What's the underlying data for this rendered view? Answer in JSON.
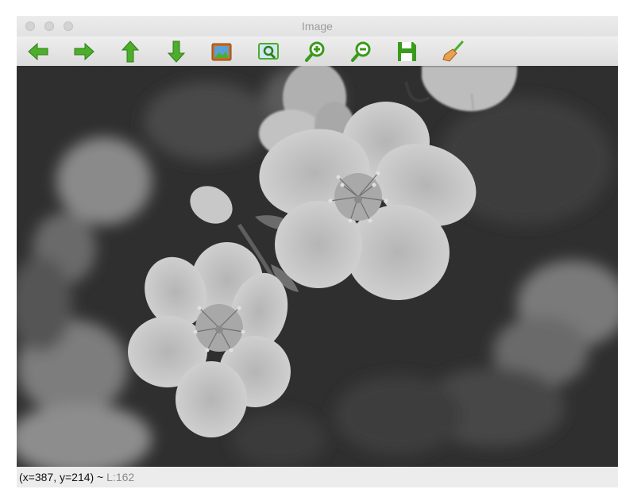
{
  "window": {
    "title": "Image"
  },
  "toolbar": {
    "buttons": [
      {
        "id": "back",
        "icon": "arrow-left-icon"
      },
      {
        "id": "forward",
        "icon": "arrow-right-icon"
      },
      {
        "id": "up",
        "icon": "arrow-up-icon"
      },
      {
        "id": "down",
        "icon": "arrow-down-icon"
      },
      {
        "id": "image",
        "icon": "picture-icon"
      },
      {
        "id": "zoom-fit",
        "icon": "zoom-fit-icon"
      },
      {
        "id": "zoom-in",
        "icon": "zoom-in-icon"
      },
      {
        "id": "zoom-out",
        "icon": "zoom-out-icon"
      },
      {
        "id": "save",
        "icon": "save-icon"
      },
      {
        "id": "clear",
        "icon": "broom-icon"
      }
    ],
    "colors": {
      "accent_green": "#4cae2a"
    }
  },
  "image": {
    "description_icon": "grayscale-flower-photo"
  },
  "statusbar": {
    "coords": "(x=387, y=214) ~",
    "luminance": "L:162"
  }
}
